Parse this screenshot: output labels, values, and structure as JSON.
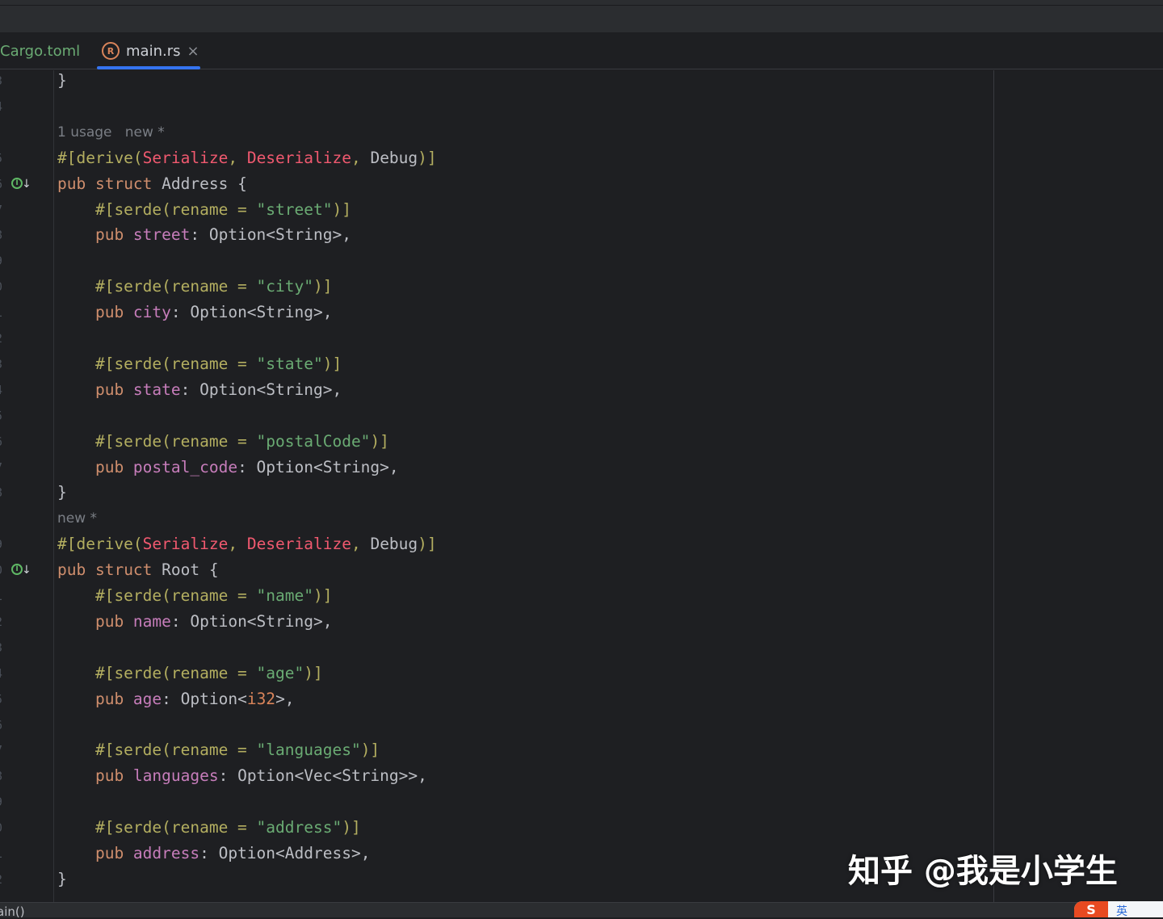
{
  "tabs": [
    {
      "label": "Cargo.toml",
      "active": false
    },
    {
      "label": "main.rs",
      "active": true
    }
  ],
  "gutter": {
    "line_numbers": [
      "3",
      "4",
      "",
      "5",
      "6",
      "7",
      "8",
      "9",
      "0",
      "1",
      "2",
      "3",
      "4",
      "5",
      "6",
      "7",
      "8",
      "",
      "9",
      "0",
      "1",
      "2",
      "3",
      "4",
      "5",
      "6",
      "7",
      "8",
      "9",
      "0",
      "1",
      "2"
    ]
  },
  "editor": {
    "lines": [
      {
        "kind": "code",
        "tokens": [
          {
            "t": "}",
            "c": "plain"
          }
        ]
      },
      {
        "kind": "blank"
      },
      {
        "kind": "hint",
        "text": "1 usage   new *"
      },
      {
        "kind": "code",
        "tokens": [
          {
            "t": "#[derive(",
            "c": "meta"
          },
          {
            "t": "Serialize",
            "c": "red"
          },
          {
            "t": ", ",
            "c": "meta"
          },
          {
            "t": "Deserialize",
            "c": "red"
          },
          {
            "t": ", ",
            "c": "meta"
          },
          {
            "t": "Debug",
            "c": "plain"
          },
          {
            "t": ")]",
            "c": "meta"
          }
        ]
      },
      {
        "kind": "code",
        "impl": true,
        "tokens": [
          {
            "t": "pub ",
            "c": "kw"
          },
          {
            "t": "struct ",
            "c": "kw"
          },
          {
            "t": "Address {",
            "c": "plain"
          }
        ]
      },
      {
        "kind": "code",
        "tokens": [
          {
            "t": "    #[serde(rename = ",
            "c": "meta"
          },
          {
            "t": "\"street\"",
            "c": "str"
          },
          {
            "t": ")]",
            "c": "meta"
          }
        ]
      },
      {
        "kind": "code",
        "tokens": [
          {
            "t": "    pub ",
            "c": "kw"
          },
          {
            "t": "street",
            "c": "field"
          },
          {
            "t": ": Option<String>,",
            "c": "plain"
          }
        ]
      },
      {
        "kind": "blank"
      },
      {
        "kind": "code",
        "tokens": [
          {
            "t": "    #[serde(rename = ",
            "c": "meta"
          },
          {
            "t": "\"city\"",
            "c": "str"
          },
          {
            "t": ")]",
            "c": "meta"
          }
        ]
      },
      {
        "kind": "code",
        "tokens": [
          {
            "t": "    pub ",
            "c": "kw"
          },
          {
            "t": "city",
            "c": "field"
          },
          {
            "t": ": Option<String>,",
            "c": "plain"
          }
        ]
      },
      {
        "kind": "blank"
      },
      {
        "kind": "code",
        "tokens": [
          {
            "t": "    #[serde(rename = ",
            "c": "meta"
          },
          {
            "t": "\"state\"",
            "c": "str"
          },
          {
            "t": ")]",
            "c": "meta"
          }
        ]
      },
      {
        "kind": "code",
        "tokens": [
          {
            "t": "    pub ",
            "c": "kw"
          },
          {
            "t": "state",
            "c": "field"
          },
          {
            "t": ": Option<String>,",
            "c": "plain"
          }
        ]
      },
      {
        "kind": "blank"
      },
      {
        "kind": "code",
        "tokens": [
          {
            "t": "    #[serde(rename = ",
            "c": "meta"
          },
          {
            "t": "\"postalCode\"",
            "c": "str"
          },
          {
            "t": ")]",
            "c": "meta"
          }
        ]
      },
      {
        "kind": "code",
        "tokens": [
          {
            "t": "    pub ",
            "c": "kw"
          },
          {
            "t": "postal_code",
            "c": "field"
          },
          {
            "t": ": Option<String>,",
            "c": "plain"
          }
        ]
      },
      {
        "kind": "code",
        "tokens": [
          {
            "t": "}",
            "c": "plain"
          }
        ]
      },
      {
        "kind": "hint",
        "text": "new *"
      },
      {
        "kind": "code",
        "tokens": [
          {
            "t": "#[derive(",
            "c": "meta"
          },
          {
            "t": "Serialize",
            "c": "red"
          },
          {
            "t": ", ",
            "c": "meta"
          },
          {
            "t": "Deserialize",
            "c": "red"
          },
          {
            "t": ", ",
            "c": "meta"
          },
          {
            "t": "Debug",
            "c": "plain"
          },
          {
            "t": ")]",
            "c": "meta"
          }
        ]
      },
      {
        "kind": "code",
        "impl": true,
        "tokens": [
          {
            "t": "pub ",
            "c": "kw"
          },
          {
            "t": "struct ",
            "c": "kw"
          },
          {
            "t": "Root {",
            "c": "plain"
          }
        ]
      },
      {
        "kind": "code",
        "tokens": [
          {
            "t": "    #[serde(rename = ",
            "c": "meta"
          },
          {
            "t": "\"name\"",
            "c": "str"
          },
          {
            "t": ")]",
            "c": "meta"
          }
        ]
      },
      {
        "kind": "code",
        "tokens": [
          {
            "t": "    pub ",
            "c": "kw"
          },
          {
            "t": "name",
            "c": "field"
          },
          {
            "t": ": Option<String>,",
            "c": "plain"
          }
        ]
      },
      {
        "kind": "blank"
      },
      {
        "kind": "code",
        "tokens": [
          {
            "t": "    #[serde(rename = ",
            "c": "meta"
          },
          {
            "t": "\"age\"",
            "c": "str"
          },
          {
            "t": ")]",
            "c": "meta"
          }
        ]
      },
      {
        "kind": "code",
        "tokens": [
          {
            "t": "    pub ",
            "c": "kw"
          },
          {
            "t": "age",
            "c": "field"
          },
          {
            "t": ": Option<",
            "c": "plain"
          },
          {
            "t": "i32",
            "c": "num"
          },
          {
            "t": ">,",
            "c": "plain"
          }
        ]
      },
      {
        "kind": "blank"
      },
      {
        "kind": "code",
        "tokens": [
          {
            "t": "    #[serde(rename = ",
            "c": "meta"
          },
          {
            "t": "\"languages\"",
            "c": "str"
          },
          {
            "t": ")]",
            "c": "meta"
          }
        ]
      },
      {
        "kind": "code",
        "tokens": [
          {
            "t": "    pub ",
            "c": "kw"
          },
          {
            "t": "languages",
            "c": "field"
          },
          {
            "t": ": Option<Vec<String>>,",
            "c": "plain"
          }
        ]
      },
      {
        "kind": "blank"
      },
      {
        "kind": "code",
        "tokens": [
          {
            "t": "    #[serde(rename = ",
            "c": "meta"
          },
          {
            "t": "\"address\"",
            "c": "str"
          },
          {
            "t": ")]",
            "c": "meta"
          }
        ]
      },
      {
        "kind": "code",
        "tokens": [
          {
            "t": "    pub ",
            "c": "kw"
          },
          {
            "t": "address",
            "c": "field"
          },
          {
            "t": ": Option<Address>,",
            "c": "plain"
          }
        ]
      },
      {
        "kind": "code",
        "tokens": [
          {
            "t": "}",
            "c": "plain"
          }
        ]
      }
    ]
  },
  "watermark": "知乎 @我是小学生",
  "status_bar": {
    "text": "ain()"
  },
  "ime": {
    "logo": "S",
    "lang": "英"
  },
  "colors": {
    "background": "#1e1f22",
    "keyword": "#cf8e6d",
    "attribute": "#b3ae60",
    "derive_trait": "#f0596f",
    "string": "#6aab73",
    "field": "#c77dbb",
    "tab_underline": "#3574f0"
  },
  "icons": {
    "rust_file": "rust-file-icon",
    "close": "close-icon",
    "implemented": "implemented-trait-icon"
  }
}
